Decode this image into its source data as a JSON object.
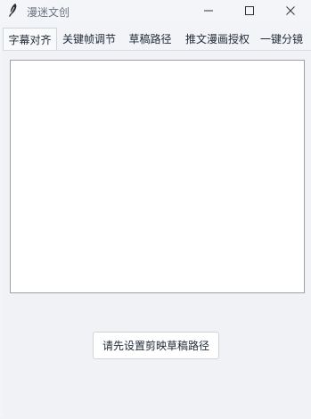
{
  "window": {
    "title": "漫迷文创",
    "icons": {
      "app": "feather-icon",
      "minimize": "minimize-icon",
      "maximize": "maximize-icon",
      "close": "close-icon"
    }
  },
  "tabs": [
    {
      "label": "字幕对齐",
      "active": true
    },
    {
      "label": "关键帧调节",
      "active": false
    },
    {
      "label": "草稿路径",
      "active": false
    },
    {
      "label": "推文漫画授权",
      "active": false
    },
    {
      "label": "一键分镜",
      "active": false
    }
  ],
  "main": {
    "text_area_value": "",
    "action_button_label": "请先设置剪映草稿路径"
  },
  "colors": {
    "background": "#f2f4f8",
    "text_area_bg": "#ffffff",
    "text_area_border": "#9aa0a6"
  }
}
